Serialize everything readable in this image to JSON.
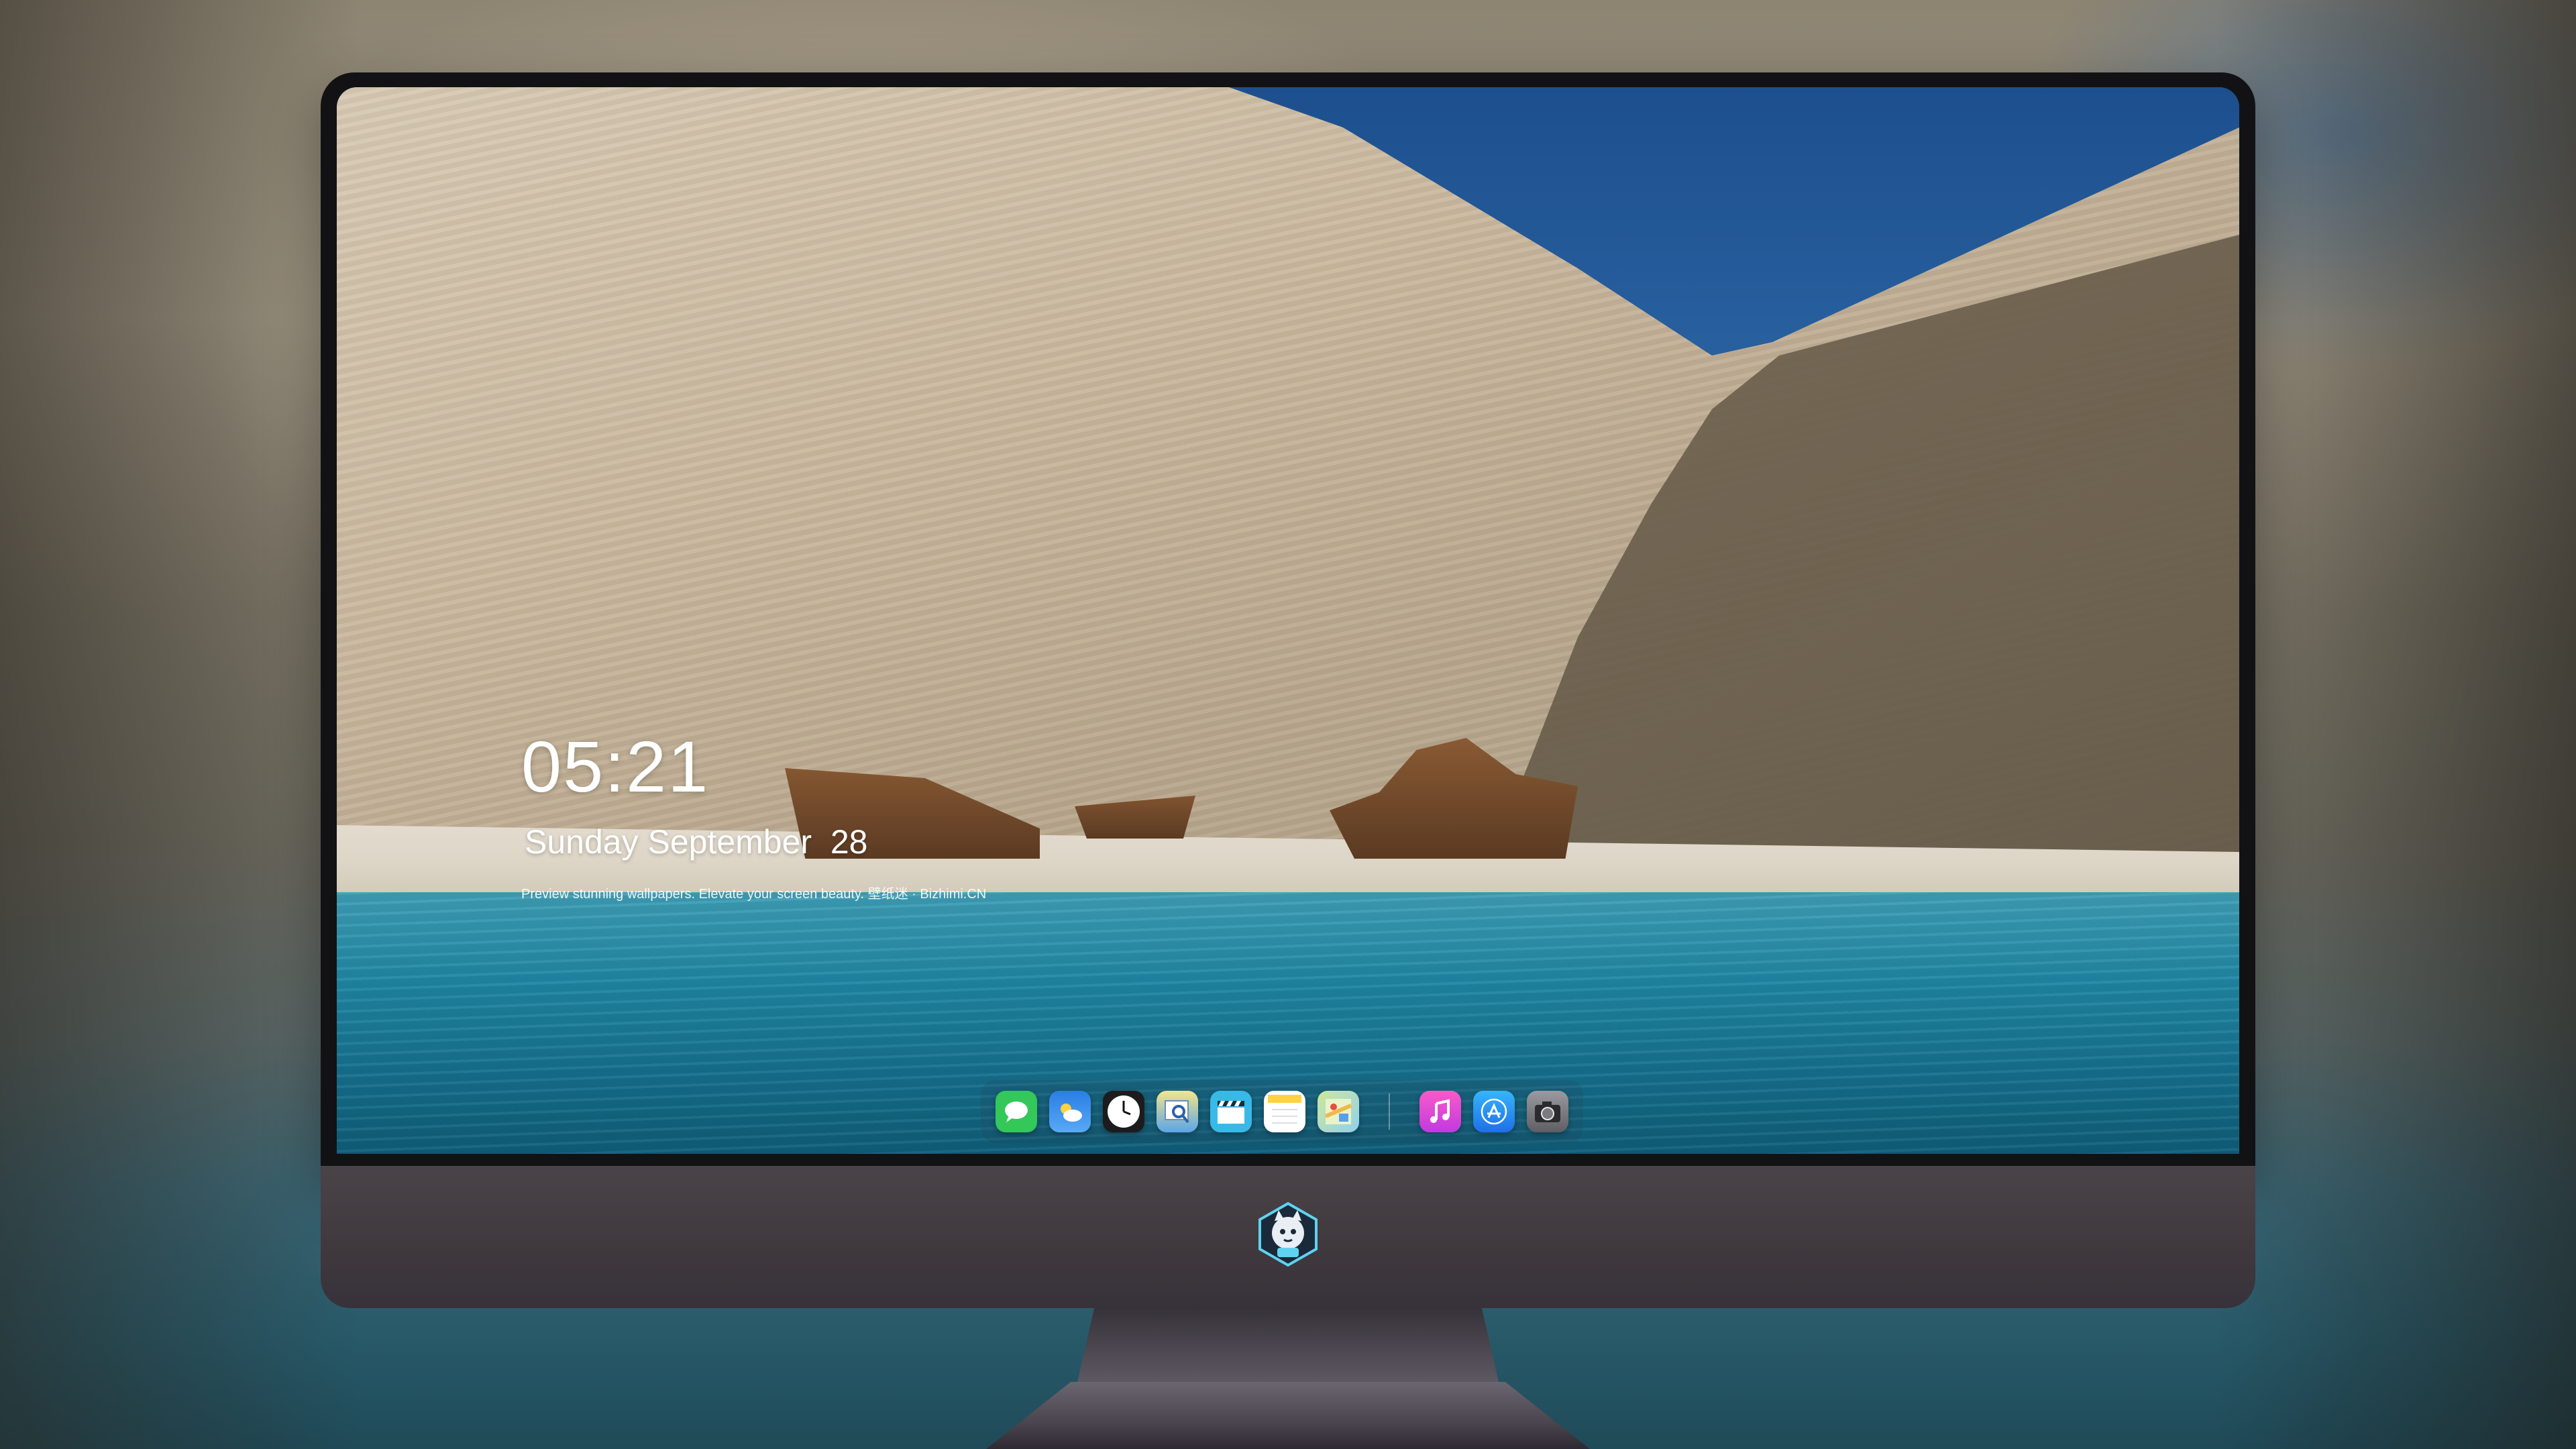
{
  "lockscreen": {
    "time": "05:21",
    "date": "Sunday September  28",
    "tagline": "Preview stunning wallpapers. Elevate your screen beauty. 壁纸迷 · Bizhimi.CN"
  },
  "dock": {
    "apps": [
      {
        "name": "messages-icon",
        "glyph": "💬",
        "color": "#34c759"
      },
      {
        "name": "weather-icon",
        "glyph": "⛅",
        "color": "#2f8ef0"
      },
      {
        "name": "clock-icon",
        "glyph": "🕑",
        "color": "#ffffff"
      },
      {
        "name": "preview-icon",
        "glyph": "🔍",
        "color": "#e9d64a"
      },
      {
        "name": "clapper-icon",
        "glyph": "🎬",
        "color": "#3fb6e6"
      },
      {
        "name": "notes-icon",
        "glyph": "📝",
        "color": "#ffd84a"
      },
      {
        "name": "maps-icon",
        "glyph": "🗺",
        "color": "#d6e8a2"
      },
      {
        "name": "music-icon",
        "glyph": "♫",
        "color": "#f04bd2"
      },
      {
        "name": "app-store-icon",
        "glyph": "A",
        "color": "#2e8df5"
      },
      {
        "name": "camera-icon",
        "glyph": "📷",
        "color": "#8e8e93"
      }
    ]
  },
  "colors": {
    "bezel": "#121214",
    "chin": "#4a4348",
    "sea": "#1f86a3",
    "sky": "#2f6aa8"
  }
}
